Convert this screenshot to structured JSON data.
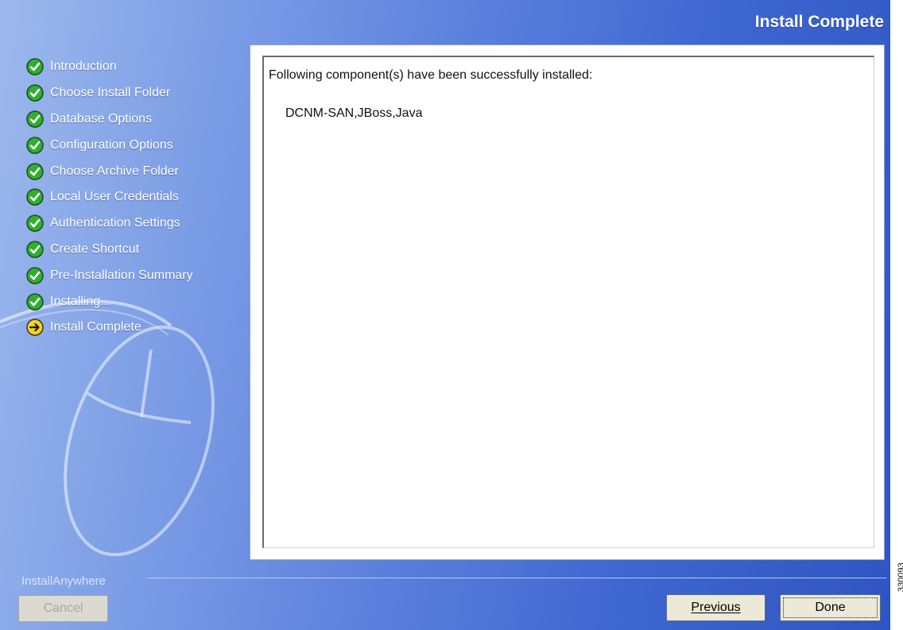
{
  "header": {
    "title": "Install Complete"
  },
  "steps": [
    {
      "label": "Introduction",
      "status": "done"
    },
    {
      "label": "Choose Install Folder",
      "status": "done"
    },
    {
      "label": "Database Options",
      "status": "done"
    },
    {
      "label": "Configuration Options",
      "status": "done"
    },
    {
      "label": "Choose Archive Folder",
      "status": "done"
    },
    {
      "label": "Local User Credentials",
      "status": "done"
    },
    {
      "label": "Authentication Settings",
      "status": "done"
    },
    {
      "label": "Create Shortcut",
      "status": "done"
    },
    {
      "label": "Pre-Installation Summary",
      "status": "done"
    },
    {
      "label": "Installing...",
      "status": "done"
    },
    {
      "label": "Install Complete",
      "status": "current"
    }
  ],
  "panel": {
    "message": "Following component(s) have been successfully installed:",
    "components": "DCNM-SAN,JBoss,Java"
  },
  "footer": {
    "brand": "InstallAnywhere",
    "cancel_label": "Cancel",
    "previous_label": "Previous",
    "done_label": "Done"
  },
  "figure_id": "330093",
  "colors": {
    "check_green": "#2fae2f",
    "current_yellow": "#f2d22a",
    "button_face": "#ece9d8"
  },
  "icons": {
    "done": "check-circle-icon",
    "current": "arrow-right-circle-icon",
    "watermark": "mouse-icon"
  }
}
